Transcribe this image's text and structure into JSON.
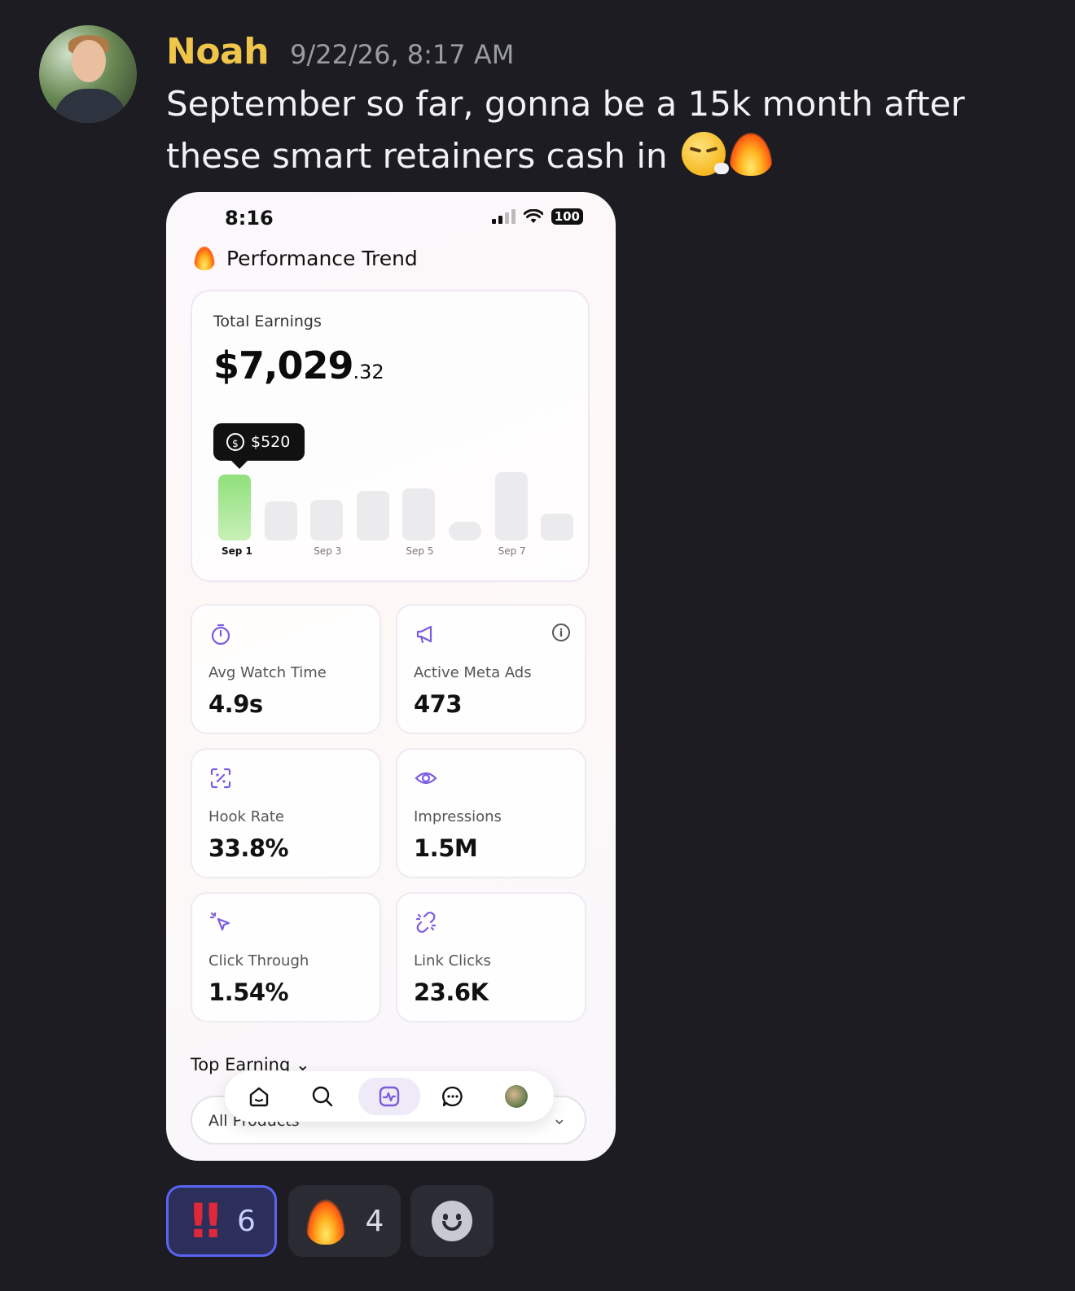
{
  "message": {
    "username": "Noah",
    "timestamp": "9/22/26, 8:17 AM",
    "text": "September so far, gonna be a 15k month after these smart retainers cash in",
    "text_emojis": [
      "exhale-face",
      "fire"
    ]
  },
  "phone": {
    "status_time": "8:16",
    "battery": "100",
    "page_title": "Performance Trend",
    "earnings": {
      "label": "Total Earnings",
      "amount_main": "$7,029",
      "amount_cents": ".32",
      "tooltip": "$520"
    },
    "chart_data": {
      "type": "bar",
      "categories": [
        "Sep 1",
        "Sep 2",
        "Sep 3",
        "Sep 4",
        "Sep 5",
        "Sep 6",
        "Sep 7",
        "Sep 8"
      ],
      "tick_labels": [
        "Sep 1",
        "Sep 3",
        "Sep 5",
        "Sep 7"
      ],
      "values": [
        520,
        310,
        320,
        390,
        410,
        150,
        540,
        210
      ],
      "highlighted": "Sep 1",
      "highlight_color": "#8fe07a"
    },
    "stats": [
      {
        "label": "Avg Watch Time",
        "value": "4.9s",
        "icon": "stopwatch-icon"
      },
      {
        "label": "Active Meta Ads",
        "value": "473",
        "icon": "megaphone-icon"
      },
      {
        "label": "Hook Rate",
        "value": "33.8%",
        "icon": "scan-percent-icon"
      },
      {
        "label": "Impressions",
        "value": "1.5M",
        "icon": "eye-icon"
      },
      {
        "label": "Click Through",
        "value": "1.54%",
        "icon": "cursor-click-icon"
      },
      {
        "label": "Link Clicks",
        "value": "23.6K",
        "icon": "broken-link-icon"
      }
    ],
    "top_earning": "Top Earning",
    "product_select": "All Products",
    "accent_color": "#7b5ce0"
  },
  "reactions": [
    {
      "emoji": "double-exclamation",
      "count": "6",
      "selected": true
    },
    {
      "emoji": "fire",
      "count": "4",
      "selected": false
    },
    {
      "emoji": "add-reaction",
      "count": "",
      "selected": false
    }
  ]
}
